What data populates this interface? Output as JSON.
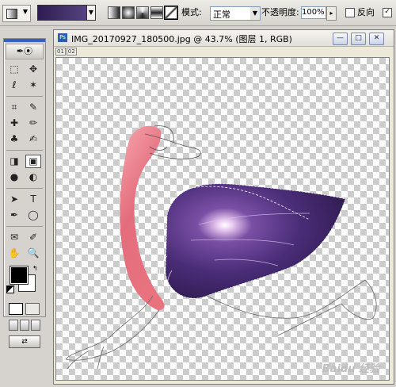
{
  "options_bar": {
    "tool_preset_icon": "gradient-tool-icon",
    "gradient_colors": [
      "#2f1c53",
      "#5c4a86"
    ],
    "gradient_type_icons": [
      "linear-gradient-icon",
      "radial-gradient-icon",
      "angle-gradient-icon",
      "reflected-gradient-icon",
      "diamond-gradient-icon"
    ],
    "mode_label": "模式:",
    "mode_value": "正常",
    "opacity_label": "不透明度:",
    "opacity_value": "100%",
    "reverse_label": "反向",
    "reverse_checked": false,
    "dither_checked": true
  },
  "toolbox": {
    "feather_icon": "feather-icon",
    "tools": [
      "marquee-icon",
      "move-icon",
      "lasso-icon",
      "magic-wand-icon",
      "crop-icon",
      "slice-icon",
      "healing-brush-icon",
      "brush-icon",
      "clone-stamp-icon",
      "history-brush-icon",
      "eraser-icon",
      "gradient-icon",
      "blur-icon",
      "dodge-icon",
      "path-select-icon",
      "type-icon",
      "pen-icon",
      "shape-icon",
      "notes-icon",
      "eyedropper-icon",
      "hand-icon",
      "zoom-icon"
    ],
    "tool_glyphs": [
      "⬚",
      "✥",
      "ℓ",
      "✶",
      "⌗",
      "✎",
      "✚",
      "✏",
      "♣",
      "✍",
      "◨",
      "▣",
      "●",
      "◐",
      "➤",
      "T",
      "✒",
      "◯",
      "✉",
      "✐",
      "✋",
      "🔍"
    ],
    "selected_tool": "gradient-icon",
    "foreground": "#000000",
    "background": "#ffffff"
  },
  "document": {
    "title": "IMG_20170927_180500.jpg @ 43.7% (图层 1, RGB)",
    "ruler_labels": [
      "01",
      "02"
    ],
    "min_glyph": "—",
    "max_glyph": "□",
    "close_glyph": "✕",
    "ps_icon_label": "Ps"
  },
  "watermark": "Baidu 经验"
}
